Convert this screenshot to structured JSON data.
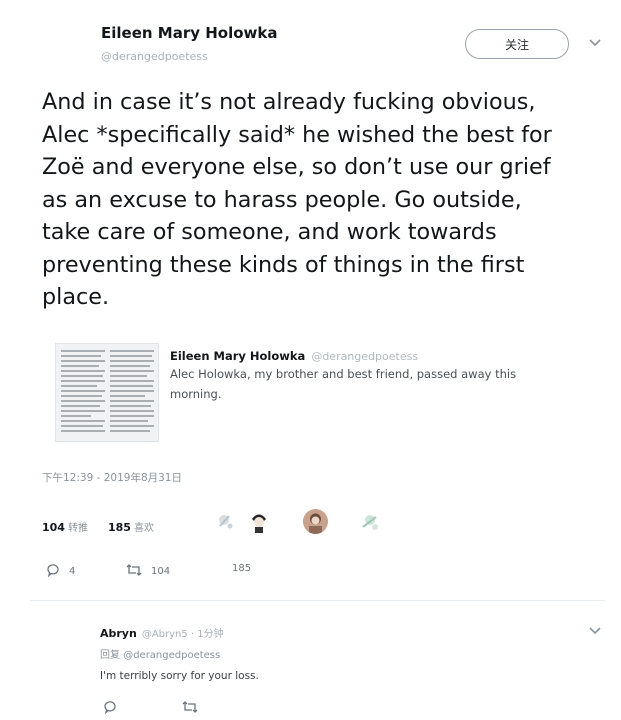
{
  "tweet": {
    "author_name": "Eileen Mary Holowka",
    "author_handle": "@derangedpoetess",
    "follow_label": "关注",
    "text": "And in case it’s not already fucking obvious,\nAlec *specifically said* he wished the best for\nZoë and everyone else, so don’t use our grief\nas an excuse to harass people. Go outside,\ntake care of someone, and work towards\npreventing these kinds of things in the first\nplace.",
    "quoted": {
      "author_name": "Eileen Mary Holowka",
      "author_handle": "@derangedpoetess",
      "text": "Alec Holowka, my brother and best friend, passed away this morning."
    },
    "timestamp": "下午12:39 - 2019年8月31日",
    "stats": {
      "retweets_count": "104",
      "retweets_label": "转推",
      "likes_count": "185",
      "likes_label": "喜欢"
    },
    "actions": {
      "reply_count": "4",
      "retweet_count": "104",
      "like_count": "185"
    }
  },
  "reply": {
    "author_name": "Abryn",
    "author_meta": "@Abryn5 · 1分钟",
    "replying_prefix": "回复",
    "replying_to": "@derangedpoetess",
    "text": "I'm terribly sorry for your loss."
  },
  "colors": {
    "text": "#14171a",
    "muted": "#8a939b",
    "divider": "#e6ecf0"
  }
}
